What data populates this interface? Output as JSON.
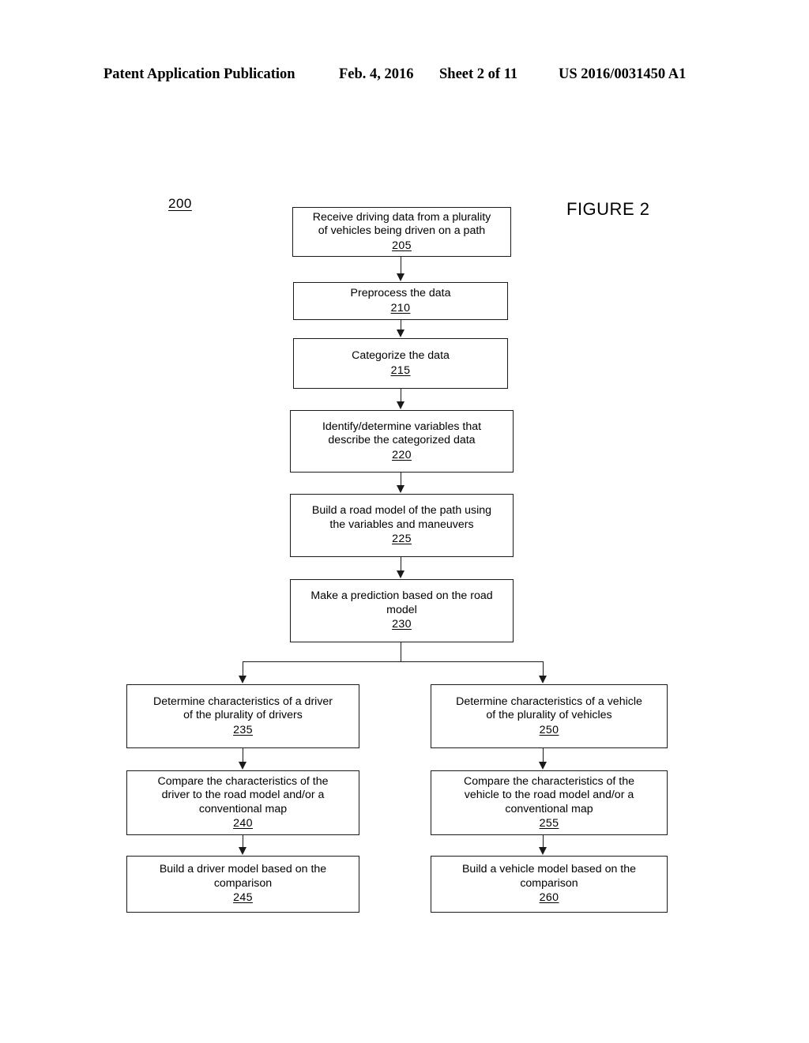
{
  "header": {
    "publication": "Patent Application Publication",
    "date": "Feb. 4, 2016",
    "sheet": "Sheet 2 of 11",
    "doc_number": "US 2016/0031450 A1"
  },
  "figure": {
    "reference_numeral": "200",
    "title": "FIGURE 2"
  },
  "nodes": [
    {
      "id": "205",
      "text": "Receive driving data from a plurality\nof vehicles being driven on a path",
      "number": "205"
    },
    {
      "id": "210",
      "text": "Preprocess the data",
      "number": "210"
    },
    {
      "id": "215",
      "text": "Categorize the data",
      "number": "215"
    },
    {
      "id": "220",
      "text": "Identify/determine variables that\ndescribe the categorized data",
      "number": "220"
    },
    {
      "id": "225",
      "text": "Build a road model of the path using\nthe variables and maneuvers",
      "number": "225"
    },
    {
      "id": "230",
      "text": "Make a prediction based on the road\nmodel",
      "number": "230"
    },
    {
      "id": "235",
      "text": "Determine characteristics of a driver\nof the plurality of drivers",
      "number": "235"
    },
    {
      "id": "240",
      "text": "Compare the characteristics of the\ndriver to the road model and/or a\nconventional map",
      "number": "240"
    },
    {
      "id": "245",
      "text": "Build a driver model based on the\ncomparison",
      "number": "245"
    },
    {
      "id": "250",
      "text": "Determine characteristics of a vehicle\nof the plurality of vehicles",
      "number": "250"
    },
    {
      "id": "255",
      "text": "Compare the characteristics of the\nvehicle to the road model and/or a\nconventional map",
      "number": "255"
    },
    {
      "id": "260",
      "text": "Build a vehicle model based on the\ncomparison",
      "number": "260"
    }
  ],
  "colors": {
    "ink": "#1a1a1a",
    "page_background": "#ffffff"
  }
}
